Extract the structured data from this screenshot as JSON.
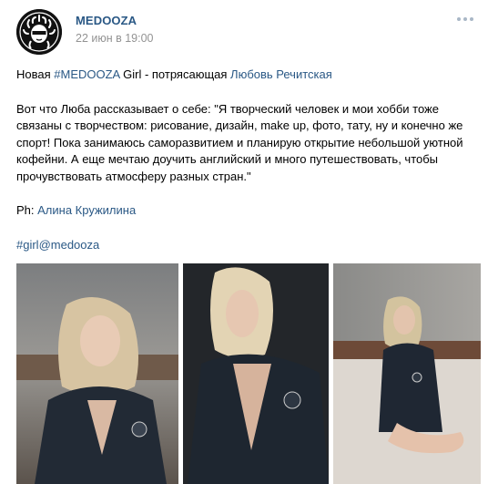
{
  "post": {
    "author": "MEDOOZA",
    "date": "22 июн в 19:00",
    "line1_prefix": "Новая ",
    "line1_tag": "#MEDOOZA",
    "line1_middle": " Girl - потрясающая ",
    "line1_person": "Любовь Речитская",
    "body_lines": [
      "Вот что Люба рассказывает о себе: \"Я творческий человек и мои хобби тоже",
      "связаны с творчеством: рисование, дизайн, make up, фото, тату, ну и конечно же",
      "спорт! Пока занимаюсь саморазвитием и планирую открытие небольшой уютной",
      "кофейни. А еще мечтаю доучить английский и много путешествовать, чтобы",
      "прочувствовать атмосферу разных стран.\""
    ],
    "credit_prefix": "Ph: ",
    "credit_name": "Алина Кружилина",
    "hashtag": "#girl@medooza"
  },
  "icons": {
    "avatar": "medusa-logo",
    "more": "more-dots-icon"
  },
  "colors": {
    "link": "#2a5885",
    "date": "#939393"
  }
}
